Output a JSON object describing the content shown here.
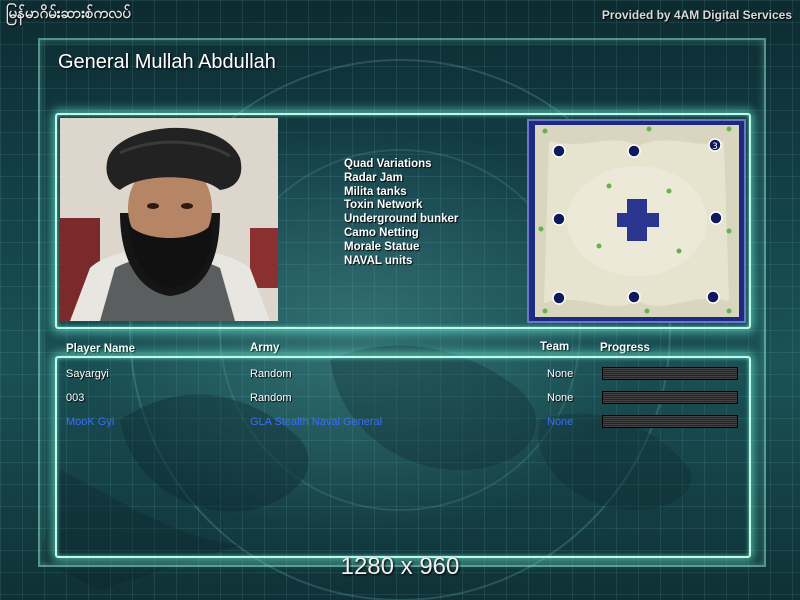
{
  "header": {
    "title": "မြန်မာဂိမ်းဆားစ်ကလပ်",
    "provided_by": "Provided by 4AM Digital Services"
  },
  "general": {
    "name": "General Mullah Abdullah",
    "portrait_alt": "general-portrait"
  },
  "upgrades": [
    "Quad Variations",
    "Radar Jam",
    "Milita tanks",
    "Toxin Network",
    "Underground bunker",
    "Camo Netting",
    "Morale Statue",
    "NAVAL units"
  ],
  "map": {
    "player_count_badge": "3"
  },
  "table": {
    "headers": {
      "player": "Player Name",
      "army": "Army",
      "team": "Team",
      "progress": "Progress"
    },
    "rows": [
      {
        "player": "Sayargyi",
        "army": "Random",
        "team": "None",
        "progress": 0
      },
      {
        "player": "003",
        "army": "Random",
        "team": "None",
        "progress": 0
      },
      {
        "player": "MooK Gyi",
        "army": "GLA Stealth Naval General",
        "team": "None",
        "progress": 0
      }
    ]
  },
  "resolution": "1280 x 960",
  "colors": {
    "panel_glow": "#bff7e8",
    "highlight_player": "#3a6cff",
    "map_border": "#6a78c8"
  }
}
